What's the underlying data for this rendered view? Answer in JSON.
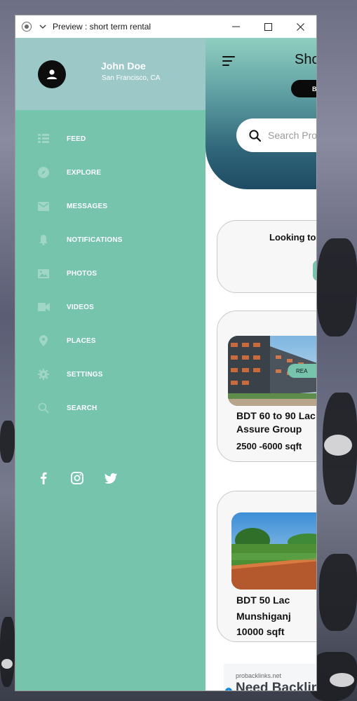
{
  "window": {
    "title": "Preview : short term rental"
  },
  "drawer": {
    "user_name": "John Doe",
    "user_location": "San Francisco, CA",
    "menu": [
      {
        "label": "FEED",
        "icon": "feed-icon"
      },
      {
        "label": "EXPLORE",
        "icon": "compass-icon"
      },
      {
        "label": "MESSAGES",
        "icon": "mail-icon"
      },
      {
        "label": "NOTIFICATIONS",
        "icon": "bell-icon"
      },
      {
        "label": "PHOTOS",
        "icon": "image-icon"
      },
      {
        "label": "VIDEOS",
        "icon": "video-camera-icon"
      },
      {
        "label": "PLACES",
        "icon": "map-pin-icon"
      },
      {
        "label": "SETTINGS",
        "icon": "gear-icon"
      },
      {
        "label": "SEARCH",
        "icon": "search-icon"
      }
    ],
    "socials": [
      "facebook-icon",
      "instagram-icon",
      "twitter-icon"
    ],
    "colors": {
      "drawer_bg": "#76c4ac",
      "profile_bg": "#9cc9c8"
    }
  },
  "main": {
    "hero_title": "Sho",
    "pill_label": "B",
    "search_placeholder": "Search Pro",
    "cta_text": "Looking to",
    "listings": [
      {
        "price": "BDT  60 to 90 Lac",
        "location": "Assure Group",
        "size": "2500 -6000 sqft",
        "tag": "REA"
      },
      {
        "price": "BDT 50 Lac",
        "location": "Munshiganj",
        "size": "10000 sqft"
      }
    ],
    "ad": {
      "domain": "probacklinks.net",
      "headline": "Need Backlin"
    }
  }
}
